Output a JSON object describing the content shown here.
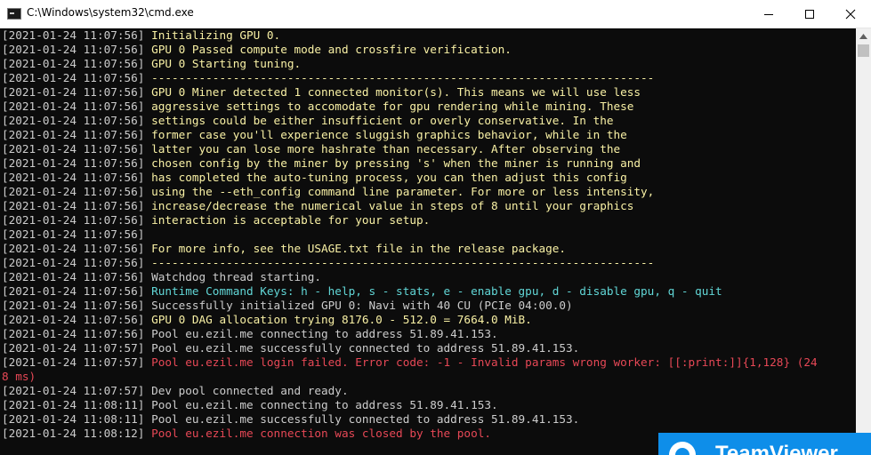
{
  "window": {
    "title": "C:\\Windows\\system32\\cmd.exe",
    "icon": "console-icon",
    "buttons": [
      "minimize-icon",
      "maximize-icon",
      "close-icon"
    ]
  },
  "colors": {
    "yellow": "#f9f1a5",
    "default": "#cccccc",
    "cyan": "#61d6d6",
    "red": "#e74856"
  },
  "console": {
    "lines": [
      {
        "ts": "[2021-01-24 11:07:56] ",
        "msg": "Initializing GPU 0.",
        "color": "yellow"
      },
      {
        "ts": "[2021-01-24 11:07:56] ",
        "msg": "GPU 0 Passed compute mode and crossfire verification.",
        "color": "yellow"
      },
      {
        "ts": "[2021-01-24 11:07:56] ",
        "msg": "GPU 0 Starting tuning.",
        "color": "yellow"
      },
      {
        "ts": "[2021-01-24 11:07:56] ",
        "msg": "--------------------------------------------------------------------------",
        "color": "yellow"
      },
      {
        "ts": "[2021-01-24 11:07:56] ",
        "msg": "GPU 0 Miner detected 1 connected monitor(s). This means we will use less",
        "color": "yellow"
      },
      {
        "ts": "[2021-01-24 11:07:56] ",
        "msg": "aggressive settings to accomodate for gpu rendering while mining. These",
        "color": "yellow"
      },
      {
        "ts": "[2021-01-24 11:07:56] ",
        "msg": "settings could be either insufficient or overly conservative. In the",
        "color": "yellow"
      },
      {
        "ts": "[2021-01-24 11:07:56] ",
        "msg": "former case you'll experience sluggish graphics behavior, while in the",
        "color": "yellow"
      },
      {
        "ts": "[2021-01-24 11:07:56] ",
        "msg": "latter you can lose more hashrate than necessary. After observing the",
        "color": "yellow"
      },
      {
        "ts": "[2021-01-24 11:07:56] ",
        "msg": "chosen config by the miner by pressing 's' when the miner is running and",
        "color": "yellow"
      },
      {
        "ts": "[2021-01-24 11:07:56] ",
        "msg": "has completed the auto-tuning process, you can then adjust this config",
        "color": "yellow"
      },
      {
        "ts": "[2021-01-24 11:07:56] ",
        "msg": "using the --eth_config command line parameter. For more or less intensity,",
        "color": "yellow"
      },
      {
        "ts": "[2021-01-24 11:07:56] ",
        "msg": "increase/decrease the numerical value in steps of 8 until your graphics",
        "color": "yellow"
      },
      {
        "ts": "[2021-01-24 11:07:56] ",
        "msg": "interaction is acceptable for your setup.",
        "color": "yellow"
      },
      {
        "ts": "[2021-01-24 11:07:56] ",
        "msg": "",
        "color": "yellow"
      },
      {
        "ts": "[2021-01-24 11:07:56] ",
        "msg": "For more info, see the USAGE.txt file in the release package.",
        "color": "yellow"
      },
      {
        "ts": "[2021-01-24 11:07:56] ",
        "msg": "--------------------------------------------------------------------------",
        "color": "yellow"
      },
      {
        "ts": "[2021-01-24 11:07:56] ",
        "msg": "Watchdog thread starting.",
        "color": "default"
      },
      {
        "ts": "[2021-01-24 11:07:56] ",
        "msg": "Runtime Command Keys: h - help, s - stats, e - enable gpu, d - disable gpu, q - quit",
        "color": "cyan"
      },
      {
        "ts": "[2021-01-24 11:07:56] ",
        "msg": "Successfully initialized GPU 0: Navi with 40 CU (PCIe 04:00.0)",
        "color": "default"
      },
      {
        "ts": "[2021-01-24 11:07:56] ",
        "msg": "GPU 0 DAG allocation trying 8176.0 - 512.0 = 7664.0 MiB.",
        "color": "yellow"
      },
      {
        "ts": "[2021-01-24 11:07:56] ",
        "msg": "Pool eu.ezil.me connecting to address 51.89.41.153.",
        "color": "default"
      },
      {
        "ts": "[2021-01-24 11:07:57] ",
        "msg": "Pool eu.ezil.me successfully connected to address 51.89.41.153.",
        "color": "default"
      },
      {
        "ts": "[2021-01-24 11:07:57] ",
        "msg": "Pool eu.ezil.me login failed. Error code: -1 - Invalid params wrong worker: [[:print:]]{1,128} (24",
        "color": "red"
      },
      {
        "ts": "",
        "msg": "8 ms)",
        "color": "red"
      },
      {
        "ts": "[2021-01-24 11:07:57] ",
        "msg": "Dev pool connected and ready.",
        "color": "default"
      },
      {
        "ts": "[2021-01-24 11:08:11] ",
        "msg": "Pool eu.ezil.me connecting to address 51.89.41.153.",
        "color": "default"
      },
      {
        "ts": "[2021-01-24 11:08:11] ",
        "msg": "Pool eu.ezil.me successfully connected to address 51.89.41.153.",
        "color": "default"
      },
      {
        "ts": "[2021-01-24 11:08:12] ",
        "msg": "Pool eu.ezil.me connection was closed by the pool.",
        "color": "red"
      }
    ]
  },
  "teamviewer": {
    "brand": "TeamViewer",
    "icon": "teamviewer-logo-icon"
  }
}
